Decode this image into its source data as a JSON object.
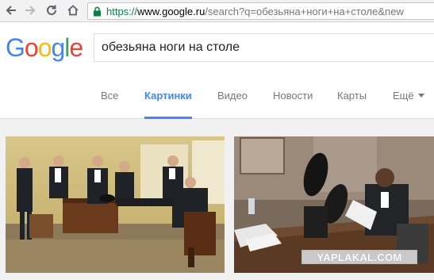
{
  "browser": {
    "url_scheme": "https://",
    "url_host": "www.google.ru",
    "url_path": "/search?q=обезьяна+ноги+на+столе&new"
  },
  "logo": {
    "text": "Google"
  },
  "search": {
    "query": "обезьяна ноги на столе"
  },
  "tabs": [
    {
      "label": "Все",
      "active": false
    },
    {
      "label": "Картинки",
      "active": true
    },
    {
      "label": "Видео",
      "active": false
    },
    {
      "label": "Новости",
      "active": false
    },
    {
      "label": "Карты",
      "active": false
    },
    {
      "label": "Ещё",
      "active": false
    }
  ],
  "results": {
    "watermark": "YAPLAKAL.COM"
  },
  "colors": {
    "accent": "#4285f4",
    "logo_blue": "#4285f4",
    "logo_red": "#ea4335",
    "logo_yellow": "#fbbc05",
    "logo_green": "#34a853",
    "secure_green": "#0b8043"
  }
}
